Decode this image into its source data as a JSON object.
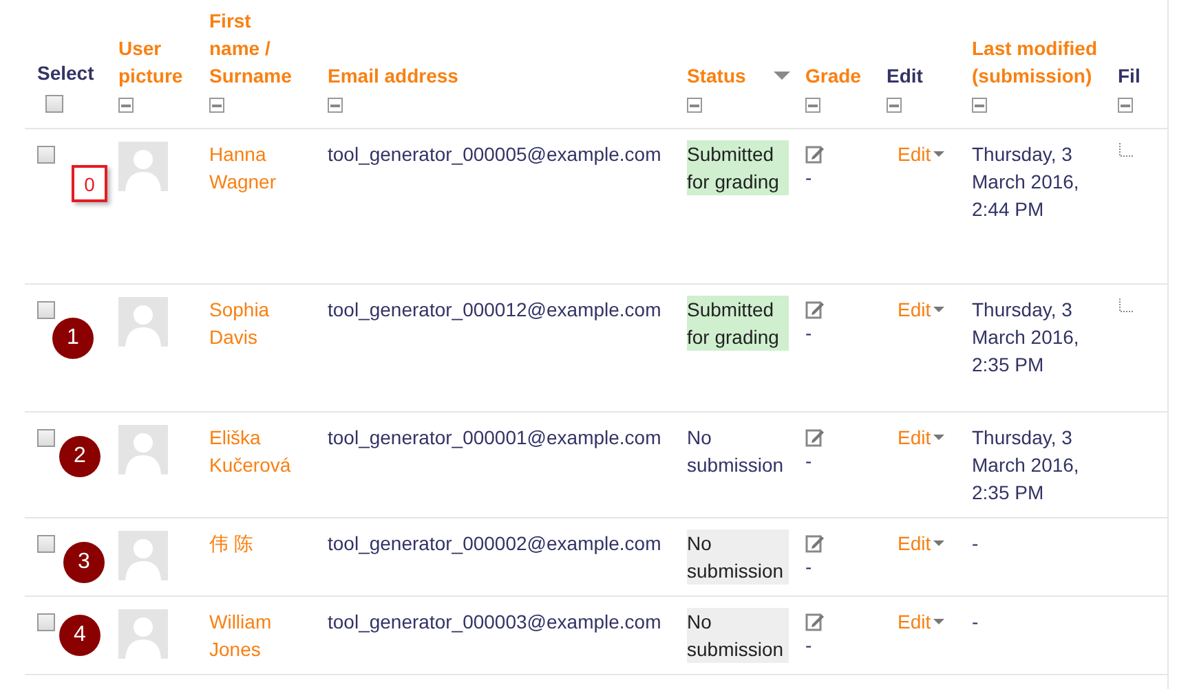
{
  "select_all": {
    "checked": false
  },
  "columns": [
    {
      "label": "Select",
      "link": false,
      "sorted": false
    },
    {
      "label": "User picture",
      "link": true,
      "sorted": false
    },
    {
      "label": "First name / Surname",
      "link": true,
      "sorted": false
    },
    {
      "label": "Email address",
      "link": true,
      "sorted": false
    },
    {
      "label": "Status",
      "link": true,
      "sorted": true
    },
    {
      "label": "Grade",
      "link": true,
      "sorted": false
    },
    {
      "label": "Edit",
      "link": false,
      "sorted": false
    },
    {
      "label": "Last modified (submission)",
      "link": true,
      "sorted": false
    },
    {
      "label": "Fil",
      "link": false,
      "sorted": false
    }
  ],
  "rows": [
    {
      "selected": false,
      "marker": {
        "kind": "box",
        "label": "0"
      },
      "name": "Hanna Wagner",
      "email": "tool_generator_000005@example.com",
      "status": {
        "text": "Submitted for grading",
        "kind": "submitted"
      },
      "grade": "-",
      "edit": "Edit",
      "last_modified": "Thursday, 3 March 2016, 2:44 PM",
      "file_icon": true
    },
    {
      "selected": false,
      "marker": {
        "kind": "circle",
        "label": "1"
      },
      "name": "Sophia Davis",
      "email": "tool_generator_000012@example.com",
      "status": {
        "text": "Submitted for grading",
        "kind": "submitted"
      },
      "grade": "-",
      "edit": "Edit",
      "last_modified": "Thursday, 3 March 2016, 2:35 PM",
      "file_icon": true
    },
    {
      "selected": false,
      "marker": {
        "kind": "circle",
        "label": "2"
      },
      "name": "Eliška Kučerová",
      "email": "tool_generator_000001@example.com",
      "status": {
        "text": "No submission",
        "kind": "plain"
      },
      "grade": "-",
      "edit": "Edit",
      "last_modified": "Thursday, 3 March 2016, 2:35 PM",
      "file_icon": false
    },
    {
      "selected": false,
      "marker": {
        "kind": "circle",
        "label": "3"
      },
      "name": "伟 陈",
      "email": "tool_generator_000002@example.com",
      "status": {
        "text": "No submission",
        "kind": "missing"
      },
      "grade": "-",
      "edit": "Edit",
      "last_modified": "-",
      "file_icon": false
    },
    {
      "selected": false,
      "marker": {
        "kind": "circle",
        "label": "4"
      },
      "name": "William Jones",
      "email": "tool_generator_000003@example.com",
      "status": {
        "text": "No submission",
        "kind": "missing"
      },
      "grade": "-",
      "edit": "Edit",
      "last_modified": "-",
      "file_icon": false
    }
  ]
}
